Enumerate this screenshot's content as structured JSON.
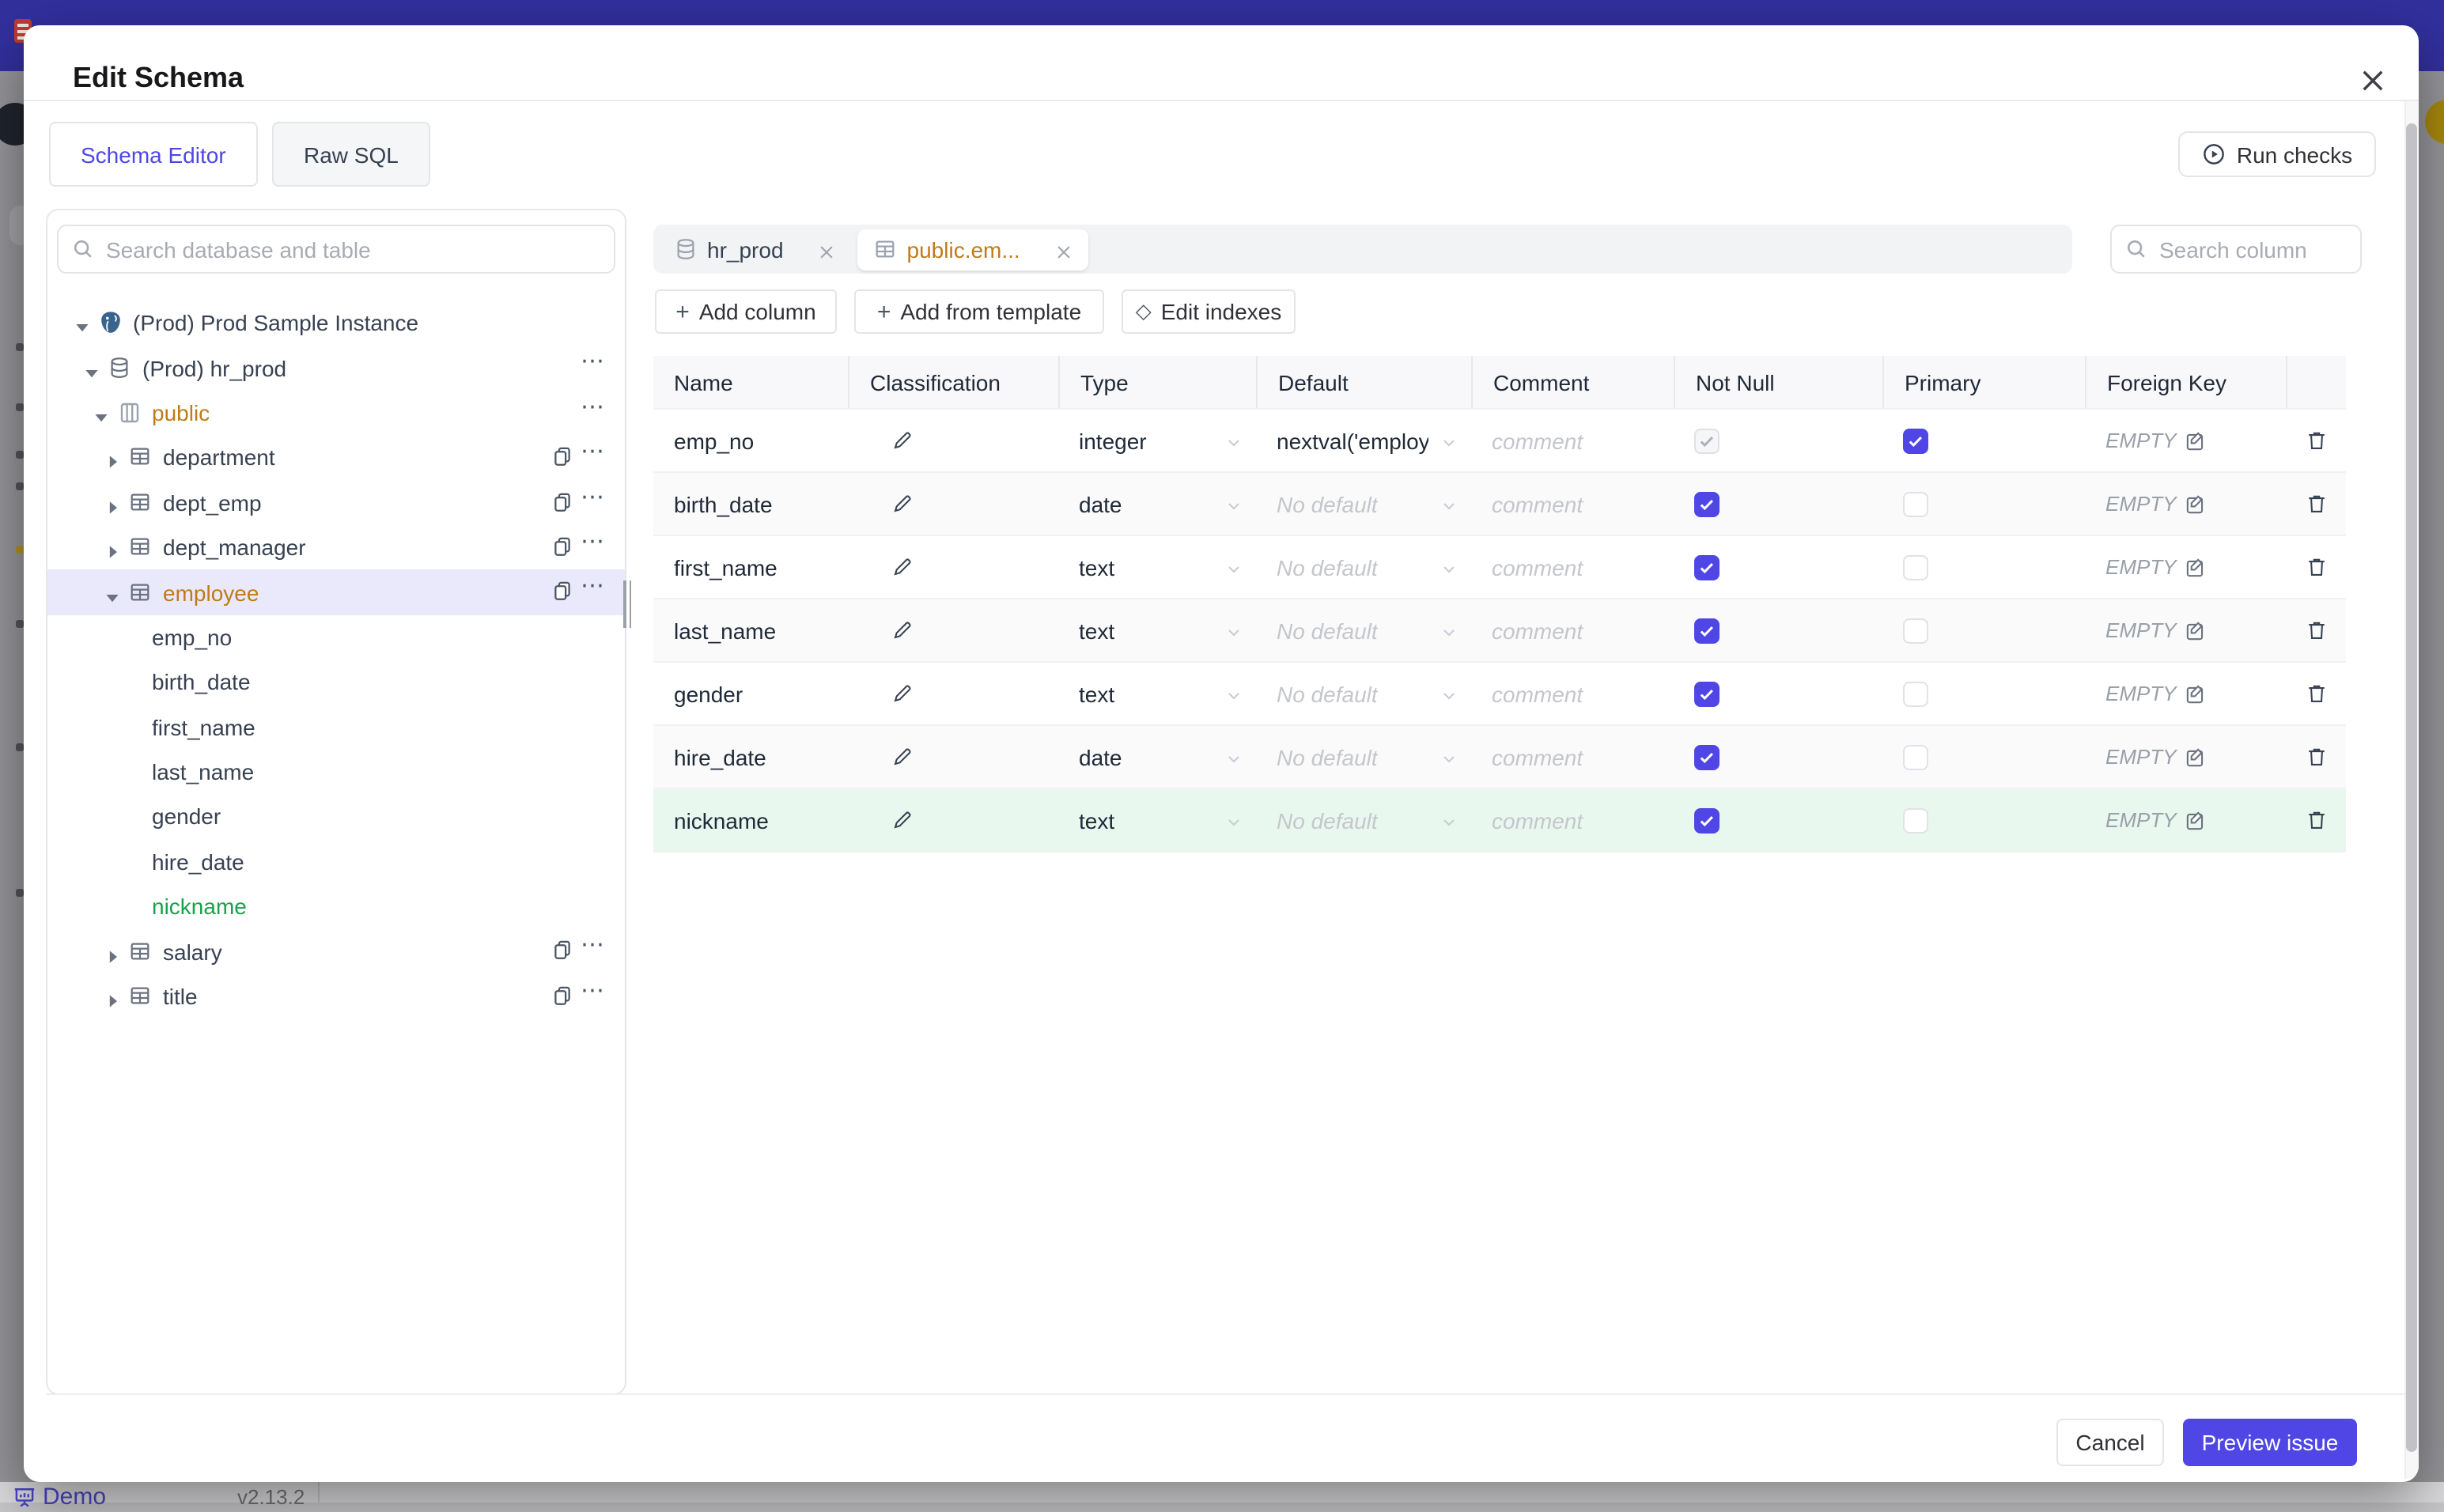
{
  "backdrop": {
    "topbar_color": "#32309E",
    "demo_label": "Demo",
    "version": "v2.13.2"
  },
  "modal": {
    "title": "Edit Schema"
  },
  "tabs": [
    {
      "label": "Schema Editor",
      "active": true
    },
    {
      "label": "Raw SQL",
      "active": false
    }
  ],
  "run_checks": {
    "label": "Run checks",
    "icon": "play-circle-icon"
  },
  "sidebar": {
    "search_placeholder": "Search database and table",
    "tree": [
      {
        "depth": 0,
        "caret": "down",
        "icon": "postgres-icon",
        "label": "(Prod) Prod Sample Instance",
        "trailing": []
      },
      {
        "depth": 1,
        "caret": "down",
        "icon": "database-icon",
        "label": "(Prod) hr_prod",
        "trailing": [
          "dots"
        ]
      },
      {
        "depth": 2,
        "caret": "down",
        "icon": "schema-icon",
        "label": "public",
        "color": "orange",
        "trailing": [
          "dots"
        ]
      },
      {
        "depth": 3,
        "caret": "right",
        "icon": "table-icon",
        "label": "department",
        "trailing": [
          "copy",
          "dots"
        ]
      },
      {
        "depth": 3,
        "caret": "right",
        "icon": "table-icon",
        "label": "dept_emp",
        "trailing": [
          "copy",
          "dots"
        ]
      },
      {
        "depth": 3,
        "caret": "right",
        "icon": "table-icon",
        "label": "dept_manager",
        "trailing": [
          "copy",
          "dots"
        ]
      },
      {
        "depth": 3,
        "caret": "down",
        "icon": "table-icon",
        "label": "employee",
        "color": "orange",
        "selected": true,
        "trailing": [
          "copy",
          "dots"
        ]
      },
      {
        "depth": 4,
        "label": "emp_no"
      },
      {
        "depth": 4,
        "label": "birth_date"
      },
      {
        "depth": 4,
        "label": "first_name"
      },
      {
        "depth": 4,
        "label": "last_name"
      },
      {
        "depth": 4,
        "label": "gender"
      },
      {
        "depth": 4,
        "label": "hire_date"
      },
      {
        "depth": 4,
        "label": "nickname",
        "color": "green"
      },
      {
        "depth": 3,
        "caret": "right",
        "icon": "table-icon",
        "label": "salary",
        "trailing": [
          "copy",
          "dots"
        ]
      },
      {
        "depth": 3,
        "caret": "right",
        "icon": "table-icon",
        "label": "title",
        "trailing": [
          "copy",
          "dots"
        ]
      }
    ]
  },
  "strip": {
    "chips": [
      {
        "icon": "database-icon",
        "label": "hr_prod",
        "active": false
      },
      {
        "icon": "table-icon",
        "label": "public.em...",
        "active": true
      }
    ],
    "search_placeholder": "Search column"
  },
  "actions": [
    {
      "icon": "plus-icon",
      "label": "Add column"
    },
    {
      "icon": "plus-icon",
      "label": "Add from template"
    },
    {
      "icon": "diamond-icon",
      "label": "Edit indexes"
    }
  ],
  "table": {
    "headers": [
      "Name",
      "Classification",
      "Type",
      "Default",
      "Comment",
      "Not Null",
      "Primary",
      "Foreign Key",
      ""
    ],
    "comment_placeholder": "comment",
    "fk_empty_label": "EMPTY",
    "rows": [
      {
        "name": "emp_no",
        "type": "integer",
        "default": "nextval('employ",
        "default_muted": false,
        "not_null": {
          "checked": true,
          "disabled": true
        },
        "primary": {
          "checked": true
        },
        "highlight": false
      },
      {
        "name": "birth_date",
        "type": "date",
        "default": "No default",
        "default_muted": true,
        "not_null": {
          "checked": true,
          "disabled": false
        },
        "primary": {
          "checked": false
        },
        "highlight": false
      },
      {
        "name": "first_name",
        "type": "text",
        "default": "No default",
        "default_muted": true,
        "not_null": {
          "checked": true,
          "disabled": false
        },
        "primary": {
          "checked": false
        },
        "highlight": false
      },
      {
        "name": "last_name",
        "type": "text",
        "default": "No default",
        "default_muted": true,
        "not_null": {
          "checked": true,
          "disabled": false
        },
        "primary": {
          "checked": false
        },
        "highlight": false
      },
      {
        "name": "gender",
        "type": "text",
        "default": "No default",
        "default_muted": true,
        "not_null": {
          "checked": true,
          "disabled": false
        },
        "primary": {
          "checked": false
        },
        "highlight": false
      },
      {
        "name": "hire_date",
        "type": "date",
        "default": "No default",
        "default_muted": true,
        "not_null": {
          "checked": true,
          "disabled": false
        },
        "primary": {
          "checked": false
        },
        "highlight": false
      },
      {
        "name": "nickname",
        "type": "text",
        "default": "No default",
        "default_muted": true,
        "not_null": {
          "checked": true,
          "disabled": false
        },
        "primary": {
          "checked": false
        },
        "highlight": true
      }
    ]
  },
  "footer": {
    "cancel_label": "Cancel",
    "primary_label": "Preview issue"
  },
  "colors": {
    "accent": "#4F46E5",
    "orange": "#C17A17",
    "green": "#16A34A",
    "selected_bg": "#EAE9FB",
    "row_green": "#E9F8EF",
    "topbar": "#32309E"
  }
}
